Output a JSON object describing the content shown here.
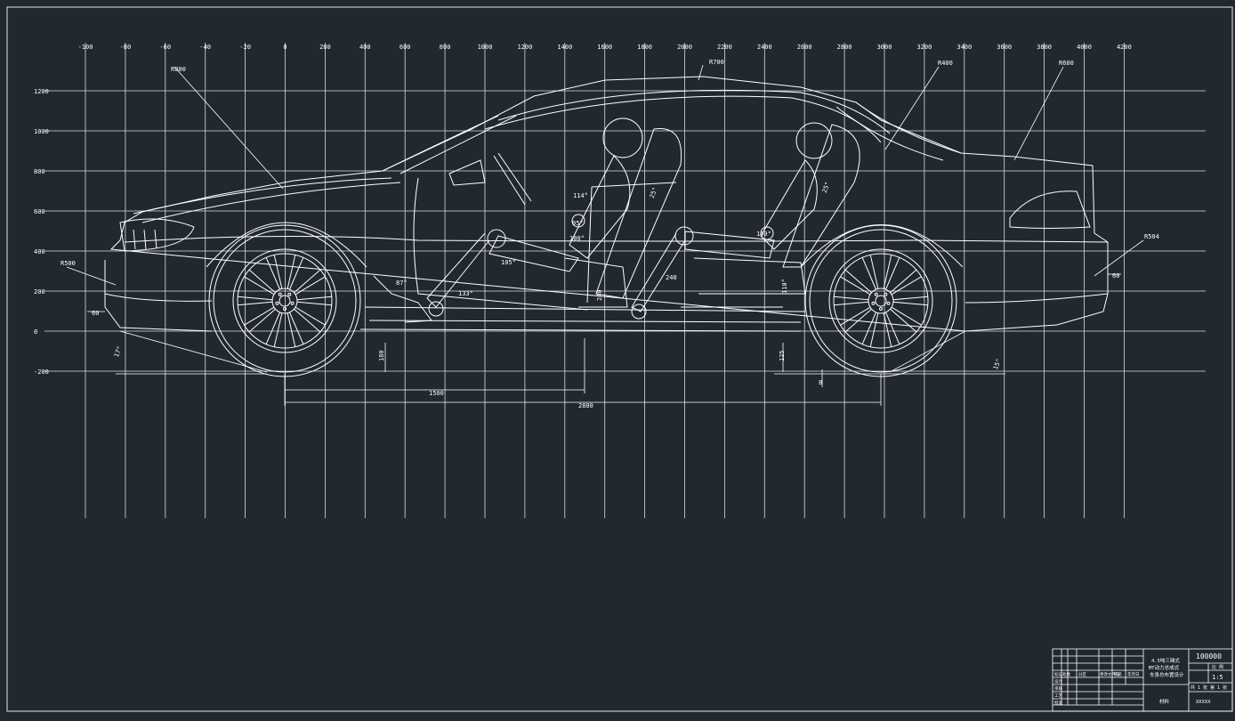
{
  "grid": {
    "columns": [
      "-100",
      "-80",
      "-60",
      "-40",
      "-20",
      "0",
      "200",
      "400",
      "600",
      "800",
      "1000",
      "1200",
      "1400",
      "1600",
      "1800",
      "2000",
      "2200",
      "2400",
      "2600",
      "2800",
      "3000",
      "3200",
      "3400",
      "3600",
      "3800",
      "4000",
      "4200"
    ],
    "rows": [
      "1200",
      "1000",
      "800",
      "600",
      "400",
      "200",
      "0",
      "-200"
    ]
  },
  "callouts": {
    "hood": "R800",
    "roof": "R700",
    "rear_glass": "R400",
    "trunk": "R600",
    "front_bumper": "R500",
    "rear_bumper": "R504"
  },
  "dimensions": {
    "front_overhang": "60",
    "rear_overhang": "60",
    "wheelbase_part": "1500",
    "wheelbase": "2880",
    "approach_angle": "17°",
    "departure_angle": "15°",
    "ground_clear_front": "180",
    "ground_clear_rear": "125",
    "rear_dim": "8",
    "mid_dim": "240",
    "hip_dim": "240"
  },
  "angles": {
    "pedal": "87°",
    "knee": "133°",
    "torso_front": "114°",
    "hip_front": "100°",
    "hip_front2": "95°",
    "seatback_front": "25°",
    "seatback_rear": "25°",
    "hip_rear": "100°",
    "leg_front": "105°",
    "leg_rear": "110°"
  },
  "title_block": {
    "title_line1": "4.5吨三厢式",
    "title_line2": "MT动力总成式",
    "title_line3": "车身总布置设计",
    "drawing_no": "100000",
    "scale_label": "比 例",
    "scale": "1:5",
    "sheet": "共 1 张 第 1 张",
    "school": "XXXXX",
    "material": "材料",
    "row_labels": [
      "标记",
      "设计",
      "审核",
      "工艺",
      "批准"
    ],
    "col_labels": [
      "处数",
      "分区",
      "更改文件号",
      "签名",
      "年月日"
    ]
  }
}
